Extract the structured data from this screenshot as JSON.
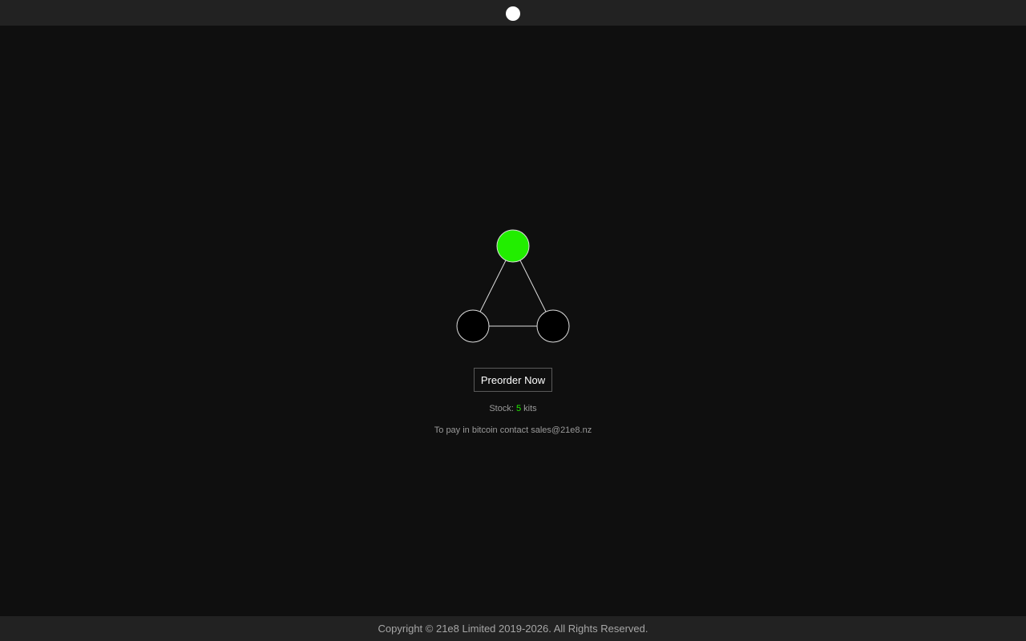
{
  "header": {
    "logo_icon": "white-dot-icon"
  },
  "main": {
    "logo": {
      "icon": "three-node-network-icon",
      "top_node_color": "#22ee00",
      "bottom_node_color": "#000000",
      "stroke_color": "#dddddd"
    },
    "preorder_label": "Preorder Now",
    "stock": {
      "prefix": "Stock: ",
      "count": "5",
      "suffix": " kits"
    },
    "bitcoin_text": "To pay in bitcoin contact sales@21e8.nz"
  },
  "footer": {
    "copyright": "Copyright © 21e8 Limited 2019-2026. All Rights Reserved."
  },
  "colors": {
    "accent": "#22ee00",
    "background": "#0f0f0f",
    "bar": "#222222"
  }
}
